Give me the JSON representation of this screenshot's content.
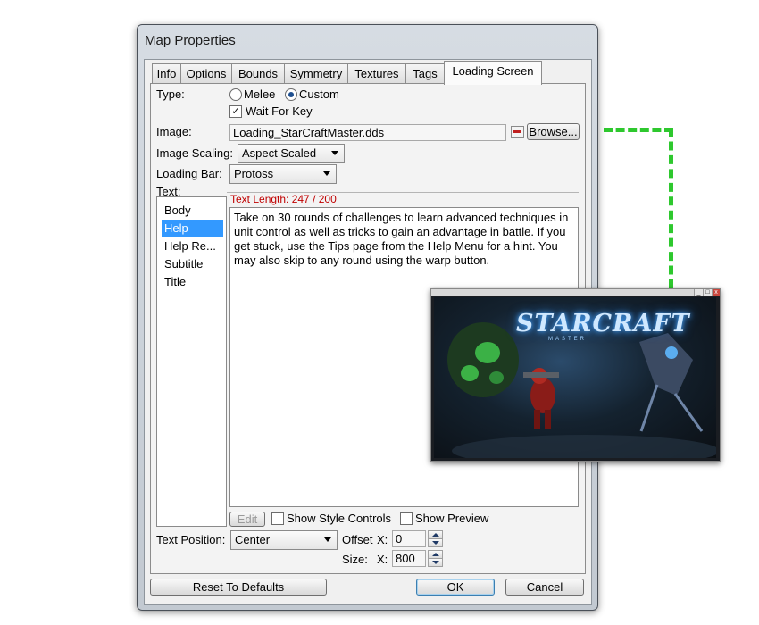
{
  "window": {
    "title": "Map Properties"
  },
  "tabs": [
    {
      "label": "Info"
    },
    {
      "label": "Options"
    },
    {
      "label": "Bounds"
    },
    {
      "label": "Symmetry"
    },
    {
      "label": "Textures"
    },
    {
      "label": "Tags"
    },
    {
      "label": "Loading Screen",
      "active": true
    }
  ],
  "form": {
    "type_label": "Type:",
    "melee_label": "Melee",
    "custom_label": "Custom",
    "type_selected": "Custom",
    "wait_for_key_label": "Wait For Key",
    "wait_for_key_checked": "✓",
    "image_label": "Image:",
    "image_value": "Loading_StarCraftMaster.dds",
    "browse_label": "Browse...",
    "image_scaling_label": "Image Scaling:",
    "image_scaling_value": "Aspect Scaled",
    "loading_bar_label": "Loading Bar:",
    "loading_bar_value": "Protoss",
    "text_label": "Text:"
  },
  "text_list": {
    "items": [
      {
        "label": "Body"
      },
      {
        "label": "Help",
        "selected": true
      },
      {
        "label": "Help Re..."
      },
      {
        "label": "Subtitle"
      },
      {
        "label": "Title"
      }
    ]
  },
  "text_editor": {
    "length_label": "Text Length: 247 / 200",
    "length_color": "#c00000",
    "content": "Take on 30 rounds of challenges to learn advanced techniques in unit control as well as tricks to gain an advantage in battle. If you get stuck, use the Tips page from the Help Menu for a hint. You may also skip to any round using the warp button."
  },
  "editor_options": {
    "edit_label": "Edit",
    "show_style_controls_label": "Show Style Controls",
    "show_preview_label": "Show Preview"
  },
  "position": {
    "text_position_label": "Text Position:",
    "text_position_value": "Center",
    "offset_label": "Offset",
    "size_label": "Size:",
    "x_label": "X:",
    "offset_x_value": "0",
    "size_x_value": "800"
  },
  "footer": {
    "reset_label": "Reset To Defaults",
    "ok_label": "OK",
    "cancel_label": "Cancel"
  },
  "preview": {
    "logo_text": "STARCRAFT",
    "logo_sub": "MASTER",
    "connector_color": "#2ec82e"
  }
}
